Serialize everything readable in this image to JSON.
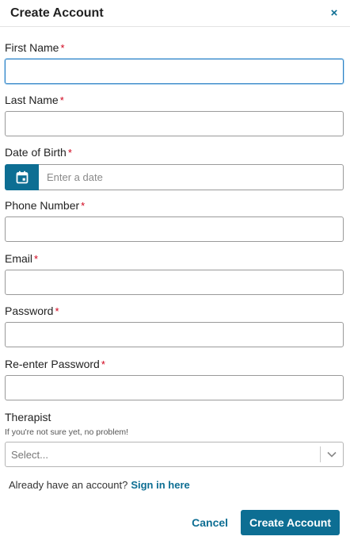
{
  "dialog": {
    "title": "Create Account",
    "close_glyph": "×"
  },
  "fields": {
    "first_name": {
      "label": "First Name",
      "required_mark": "*",
      "value": ""
    },
    "last_name": {
      "label": "Last Name",
      "required_mark": "*",
      "value": ""
    },
    "dob": {
      "label": "Date of Birth",
      "required_mark": "*",
      "placeholder": "Enter a date",
      "button_icon": "calendar-icon"
    },
    "phone": {
      "label": "Phone Number",
      "required_mark": "*",
      "value": ""
    },
    "email": {
      "label": "Email",
      "required_mark": "*",
      "value": ""
    },
    "password": {
      "label": "Password",
      "required_mark": "*",
      "value": ""
    },
    "reenter_password": {
      "label": "Re-enter Password",
      "required_mark": "*",
      "value": ""
    },
    "therapist": {
      "label": "Therapist",
      "hint": "If you're not sure yet, no problem!",
      "selected": "Select..."
    }
  },
  "signin": {
    "prompt": "Already have an account?",
    "link": "Sign in here"
  },
  "footer": {
    "cancel_label": "Cancel",
    "create_label": "Create Account"
  },
  "colors": {
    "accent": "#0d6e93",
    "required": "#d0021b",
    "focus_border": "#2b80c5"
  }
}
